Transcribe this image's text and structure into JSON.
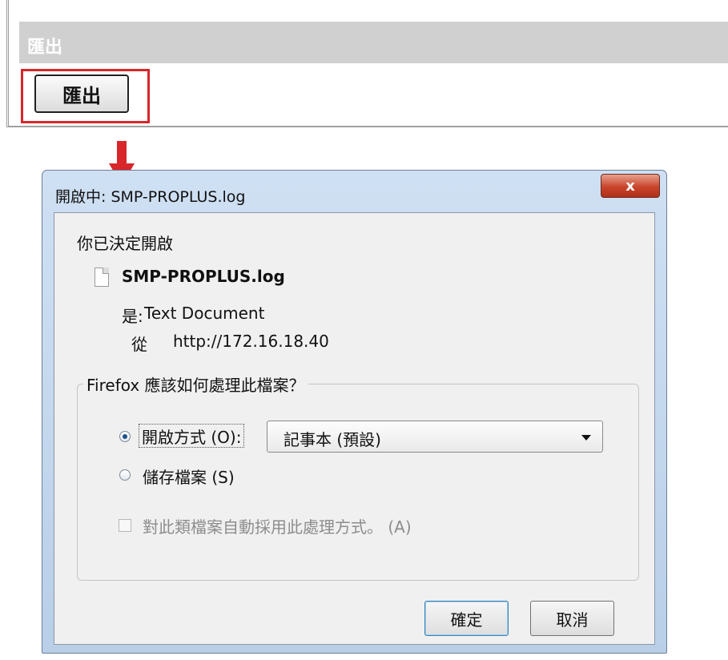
{
  "export_panel": {
    "header": "匯出",
    "button_label": "匯出"
  },
  "dialog": {
    "title": "開啟中: SMP-PROPLUS.log",
    "close_label": "x",
    "intro": "你已決定開啟",
    "filename": "SMP-PROPLUS.log",
    "type_label": "是:",
    "type_value": "Text Document",
    "from_label": "從",
    "from_value": "http://172.16.18.40",
    "group_label": "Firefox 應該如何處理此檔案？",
    "open_with_label": "開啟方式 (O):",
    "open_with_app": "記事本 (預設)",
    "save_label": "儲存檔案 (S)",
    "auto_label": "對此類檔案自動採用此處理方式。 (A)",
    "ok_label": "確定",
    "cancel_label": "取消"
  },
  "colors": {
    "highlight": "#d9262b",
    "header_bg": "#d0d0d0",
    "dialog_frame": "#c2d6ee",
    "close_button": "#c9452b"
  }
}
